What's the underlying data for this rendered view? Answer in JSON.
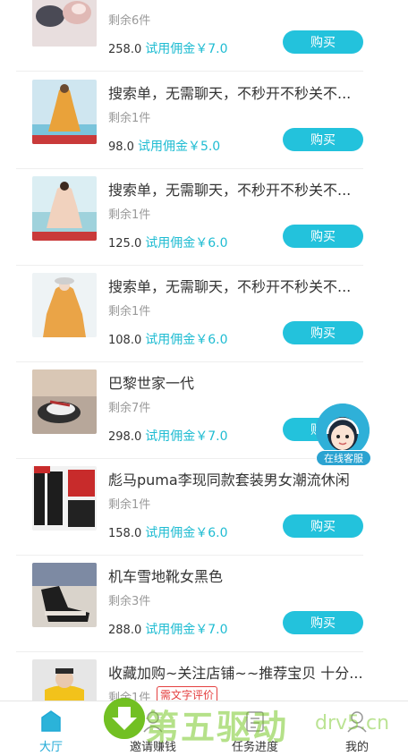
{
  "items": [
    {
      "title": "",
      "remain": "剩余6件",
      "price": "258.0",
      "commission": "试用佣金￥7.0",
      "buy": "购买"
    },
    {
      "title": "搜索单，无需聊天，不秒开不秒关不...",
      "remain": "剩余1件",
      "price": "98.0",
      "commission": "试用佣金￥5.0",
      "buy": "购买"
    },
    {
      "title": "搜索单，无需聊天，不秒开不秒关不...",
      "remain": "剩余1件",
      "price": "125.0",
      "commission": "试用佣金￥6.0",
      "buy": "购买"
    },
    {
      "title": "搜索单，无需聊天，不秒开不秒关不...",
      "remain": "剩余1件",
      "price": "108.0",
      "commission": "试用佣金￥6.0",
      "buy": "购买"
    },
    {
      "title": "巴黎世家一代",
      "remain": "剩余7件",
      "price": "298.0",
      "commission": "试用佣金￥7.0",
      "buy": "购买"
    },
    {
      "title": "彪马puma李现同款套装男女潮流休闲",
      "remain": "剩余1件",
      "price": "158.0",
      "commission": "试用佣金￥6.0",
      "buy": "购买"
    },
    {
      "title": "机车雪地靴女黑色",
      "remain": "剩余3件",
      "price": "288.0",
      "commission": "试用佣金￥7.0",
      "buy": "购买"
    },
    {
      "title": "收藏加购~关注店铺~~推荐宝贝 十分...",
      "remain": "剩余1件",
      "tag": "需文字评价"
    }
  ],
  "float_service": {
    "label": "在线客服"
  },
  "tabbar": [
    {
      "label": "大厅",
      "icon": "hall-icon",
      "active": true
    },
    {
      "label": "邀请赚钱",
      "icon": "invite-icon"
    },
    {
      "label": "任务进度",
      "icon": "progress-icon"
    },
    {
      "label": "我的",
      "icon": "profile-icon"
    }
  ],
  "watermark": {
    "text": "第五驱动",
    "domain": "drv5.cn"
  },
  "colors": {
    "accent": "#23c2dc",
    "commission": "#1fbcd2",
    "tag": "#e43f3f",
    "active_tab": "#1fa9d6"
  }
}
